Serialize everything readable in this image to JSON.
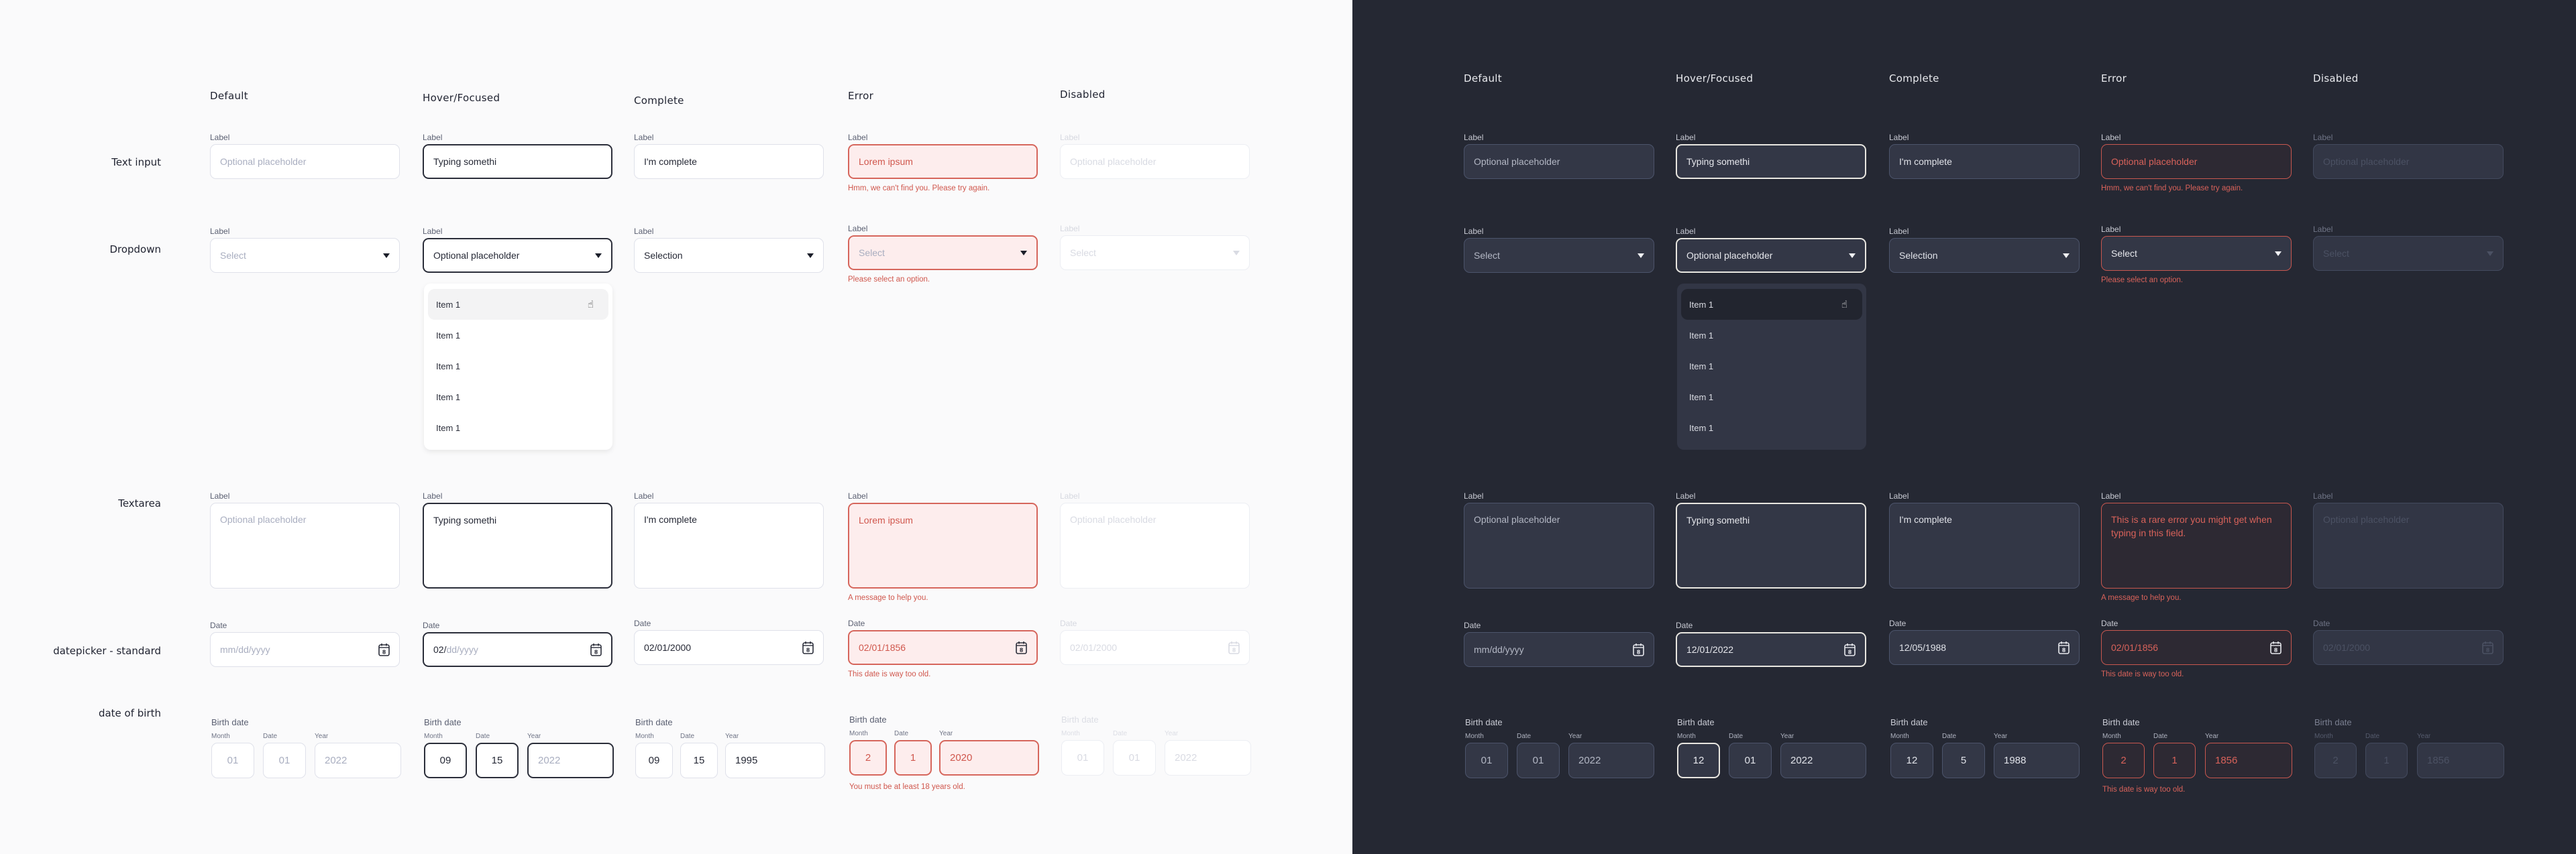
{
  "columns": [
    "Default",
    "Hover/Focused",
    "Complete",
    "Error",
    "Disabled"
  ],
  "row_labels": {
    "text_input": "Text input",
    "dropdown": "Dropdown",
    "textarea": "Textarea",
    "datepicker": "datepicker - standard",
    "dob": "date of birth"
  },
  "icons": {
    "dropdown": "caret-down-icon",
    "datepicker": "calendar-icon",
    "cursor": "hand-pointer-cursor-icon"
  },
  "colors": {
    "light_bg": "#fafafb",
    "dark_bg": "#252833",
    "error": "#d6665c",
    "focus_light": "#2b2e3a",
    "focus_dark": "#e8e6e0"
  },
  "themes": {
    "light": {
      "text_input": [
        {
          "state": "default",
          "label": "Label",
          "value": "Optional placeholder",
          "placeholder": true
        },
        {
          "state": "focus",
          "label": "Label",
          "value": "Typing somethi"
        },
        {
          "state": "complete",
          "label": "Label",
          "value": "I'm complete"
        },
        {
          "state": "error",
          "label": "Label",
          "value": "Lorem ipsum",
          "message": "Hmm, we can't find you. Please try again."
        },
        {
          "state": "disabled",
          "label": "Label",
          "value": "Optional placeholder"
        }
      ],
      "dropdown": [
        {
          "state": "default",
          "label": "Label",
          "value": "Select",
          "placeholder": true
        },
        {
          "state": "focus",
          "label": "Label",
          "value": "Optional placeholder",
          "open": true
        },
        {
          "state": "complete",
          "label": "Label",
          "value": "Selection"
        },
        {
          "state": "error",
          "label": "Label",
          "value": "Select",
          "placeholder": true,
          "message": "Please select an option."
        },
        {
          "state": "disabled",
          "label": "Label",
          "value": "Select"
        }
      ],
      "dropdown_items": [
        "Item 1",
        "Item 1",
        "Item 1",
        "Item 1",
        "Item 1"
      ],
      "textarea": [
        {
          "state": "default",
          "label": "Label",
          "value": "Optional placeholder",
          "placeholder": true
        },
        {
          "state": "focus",
          "label": "Label",
          "value": "Typing somethi"
        },
        {
          "state": "complete",
          "label": "Label",
          "value": "I'm complete"
        },
        {
          "state": "error",
          "label": "Label",
          "value": "Lorem ipsum",
          "message": "A message to help you."
        },
        {
          "state": "disabled",
          "label": "Label",
          "value": "Optional placeholder"
        }
      ],
      "datepicker": [
        {
          "state": "default",
          "label": "Date",
          "value": "mm/dd/yyyy",
          "placeholder": true
        },
        {
          "state": "focus",
          "label": "Date",
          "value": "02/",
          "value_rest": "dd/yyyy"
        },
        {
          "state": "complete",
          "label": "Date",
          "value": "02/01/2000"
        },
        {
          "state": "error",
          "label": "Date",
          "value": "02/01/1856",
          "message": "This date is way too old."
        },
        {
          "state": "disabled",
          "label": "Date",
          "value": "02/01/2000"
        }
      ],
      "dob": [
        {
          "state": "default",
          "label": "Birth date",
          "month_label": "Month",
          "date_label": "Date",
          "year_label": "Year",
          "month": "01",
          "date": "01",
          "year": "2022",
          "placeholder": true
        },
        {
          "state": "focus",
          "label": "Birth date",
          "month_label": "Month",
          "date_label": "Date",
          "year_label": "Year",
          "month": "09",
          "date": "15",
          "year": "2022",
          "focus_parts": [
            "month",
            "date",
            "year"
          ],
          "placeholder_parts": [
            "year"
          ]
        },
        {
          "state": "complete",
          "label": "Birth date",
          "month_label": "Month",
          "date_label": "Date",
          "year_label": "Year",
          "month": "09",
          "date": "15",
          "year": "1995"
        },
        {
          "state": "error",
          "label": "Birth date",
          "month_label": "Month",
          "date_label": "Date",
          "year_label": "Year",
          "month": "2",
          "date": "1",
          "year": "2020",
          "message": "You must be at least 18 years old."
        },
        {
          "state": "disabled",
          "label": "Birth date",
          "month_label": "Month",
          "date_label": "Date",
          "year_label": "Year",
          "month": "01",
          "date": "01",
          "year": "2022"
        }
      ]
    },
    "dark": {
      "text_input": [
        {
          "state": "default",
          "label": "Label",
          "value": "Optional placeholder",
          "placeholder": true
        },
        {
          "state": "focus",
          "label": "Label",
          "value": "Typing somethi"
        },
        {
          "state": "complete",
          "label": "Label",
          "value": "I'm complete"
        },
        {
          "state": "error",
          "label": "Label",
          "value": "Optional placeholder",
          "message": "Hmm, we can't find you. Please try again."
        },
        {
          "state": "disabled",
          "label": "Label",
          "value": "Optional placeholder"
        }
      ],
      "dropdown": [
        {
          "state": "default",
          "label": "Label",
          "value": "Select",
          "placeholder": true
        },
        {
          "state": "focus",
          "label": "Label",
          "value": "Optional placeholder",
          "open": true
        },
        {
          "state": "complete",
          "label": "Label",
          "value": "Selection"
        },
        {
          "state": "error",
          "label": "Label",
          "value": "Select",
          "message": "Please select an option."
        },
        {
          "state": "disabled",
          "label": "Label",
          "value": "Select"
        }
      ],
      "dropdown_items": [
        "Item 1",
        "Item 1",
        "Item 1",
        "Item 1",
        "Item 1"
      ],
      "textarea": [
        {
          "state": "default",
          "label": "Label",
          "value": "Optional placeholder",
          "placeholder": true
        },
        {
          "state": "focus",
          "label": "Label",
          "value": "Typing somethi"
        },
        {
          "state": "complete",
          "label": "Label",
          "value": "I'm complete"
        },
        {
          "state": "error",
          "label": "Label",
          "value": "This is a rare error you might get when typing in this field.",
          "message": "A message to help you."
        },
        {
          "state": "disabled",
          "label": "Label",
          "value": "Optional placeholder"
        }
      ],
      "datepicker": [
        {
          "state": "default",
          "label": "Date",
          "value": "mm/dd/yyyy",
          "placeholder": true
        },
        {
          "state": "focus",
          "label": "Date",
          "value": "12/01/2022"
        },
        {
          "state": "complete",
          "label": "Date",
          "value": "12/05/1988"
        },
        {
          "state": "error",
          "label": "Date",
          "value": "02/01/1856",
          "message": "This date is way too old."
        },
        {
          "state": "disabled",
          "label": "Date",
          "value": "02/01/2000"
        }
      ],
      "dob": [
        {
          "state": "default",
          "label": "Birth date",
          "month_label": "Month",
          "date_label": "Date",
          "year_label": "Year",
          "month": "01",
          "date": "01",
          "year": "2022"
        },
        {
          "state": "focus",
          "label": "Birth date",
          "month_label": "Month",
          "date_label": "Date",
          "year_label": "Year",
          "month": "12",
          "date": "01",
          "year": "2022",
          "focus_parts": [
            "month"
          ]
        },
        {
          "state": "complete",
          "label": "Birth date",
          "month_label": "Month",
          "date_label": "Date",
          "year_label": "Year",
          "month": "12",
          "date": "5",
          "year": "1988"
        },
        {
          "state": "error",
          "label": "Birth date",
          "month_label": "Month",
          "date_label": "Date",
          "year_label": "Year",
          "month": "2",
          "date": "1",
          "year": "1856",
          "message": "This date is way too old."
        },
        {
          "state": "disabled",
          "label": "Birth date",
          "month_label": "Month",
          "date_label": "Date",
          "year_label": "Year",
          "month": "2",
          "date": "1",
          "year": "1856"
        }
      ]
    }
  }
}
